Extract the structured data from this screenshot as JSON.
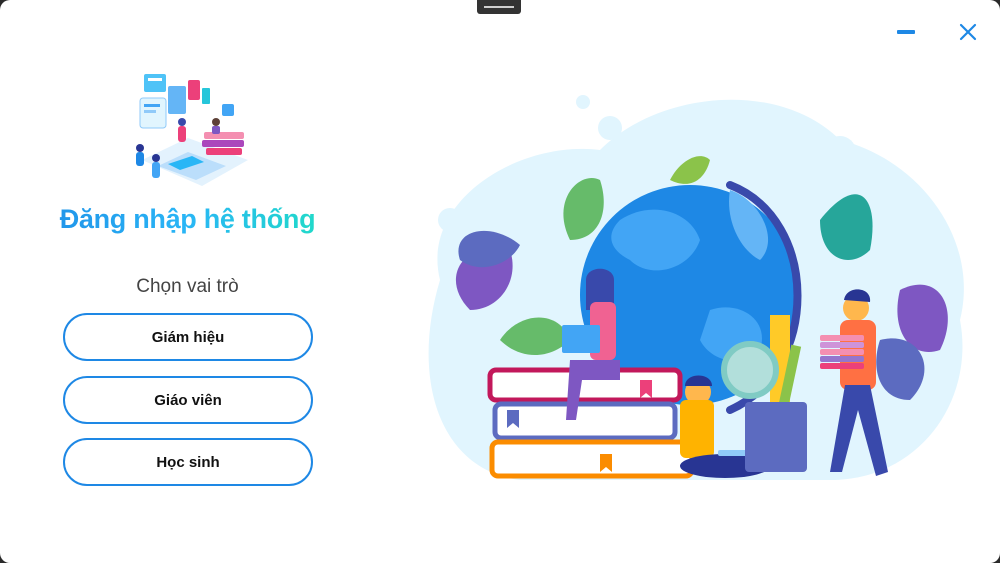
{
  "window": {
    "controls": {
      "minimize": "minimize-icon",
      "close": "close-icon"
    }
  },
  "login": {
    "title": "Đăng nhập hệ thống",
    "role_prompt": "Chọn vai trò",
    "roles": [
      {
        "label": "Giám hiệu"
      },
      {
        "label": "Giáo viên"
      },
      {
        "label": "Học sinh"
      }
    ]
  },
  "colors": {
    "accent": "#1e88e5",
    "title_gradient_start": "#1e88e5",
    "title_gradient_end": "#1de9b6"
  }
}
